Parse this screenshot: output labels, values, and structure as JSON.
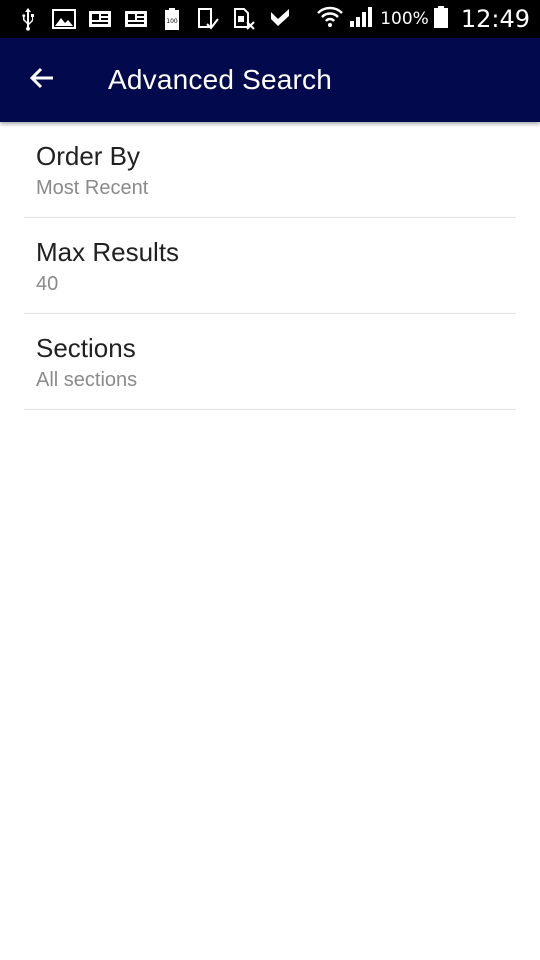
{
  "status_bar": {
    "notification_icons": [
      "usb-icon",
      "image-icon",
      "news-icon",
      "news-icon",
      "battery-100-icon",
      "phone-check-icon",
      "sim-x-icon",
      "check-icon"
    ],
    "battery_percent": "100%",
    "time": "12:49"
  },
  "app_bar": {
    "title": "Advanced Search",
    "back_icon": "arrow-left-icon",
    "background_color": "#020a4d"
  },
  "settings": {
    "items": [
      {
        "title": "Order By",
        "summary": "Most Recent"
      },
      {
        "title": "Max Results",
        "summary": "40"
      },
      {
        "title": "Sections",
        "summary": "All sections"
      }
    ]
  }
}
